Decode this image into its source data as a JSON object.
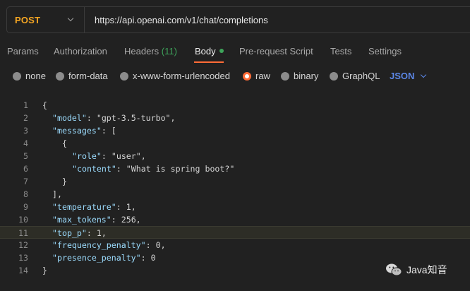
{
  "request": {
    "method": "POST",
    "url": "https://api.openai.com/v1/chat/completions"
  },
  "tabs": [
    {
      "label": "Params"
    },
    {
      "label": "Authorization"
    },
    {
      "label": "Headers",
      "count": "(11)"
    },
    {
      "label": "Body",
      "active": true
    },
    {
      "label": "Pre-request Script"
    },
    {
      "label": "Tests"
    },
    {
      "label": "Settings"
    }
  ],
  "body_options": [
    {
      "label": "none"
    },
    {
      "label": "form-data"
    },
    {
      "label": "x-www-form-urlencoded"
    },
    {
      "label": "raw",
      "selected": true
    },
    {
      "label": "binary"
    },
    {
      "label": "GraphQL"
    }
  ],
  "language": "JSON",
  "editor": {
    "highlighted_line": 11,
    "lines": [
      {
        "n": "1",
        "text": "{"
      },
      {
        "n": "2",
        "text": "\"model\": \"gpt-3.5-turbo\","
      },
      {
        "n": "3",
        "text": "\"messages\": ["
      },
      {
        "n": "4",
        "text": "{"
      },
      {
        "n": "5",
        "text": "\"role\": \"user\","
      },
      {
        "n": "6",
        "text": "\"content\": \"What is spring boot?\""
      },
      {
        "n": "7",
        "text": "}"
      },
      {
        "n": "8",
        "text": "],"
      },
      {
        "n": "9",
        "text": "\"temperature\": 1,"
      },
      {
        "n": "10",
        "text": "\"max_tokens\": 256,"
      },
      {
        "n": "11",
        "text": "\"top_p\": 1,"
      },
      {
        "n": "12",
        "text": "\"frequency_penalty\": 0,"
      },
      {
        "n": "13",
        "text": "\"presence_penalty\": 0"
      },
      {
        "n": "14",
        "text": "}"
      }
    ]
  },
  "watermark": {
    "text": "Java知音"
  },
  "colors": {
    "accent": "#ff6c37",
    "method": "#f5a623",
    "success": "#3ea45b",
    "link": "#5b86e5"
  }
}
